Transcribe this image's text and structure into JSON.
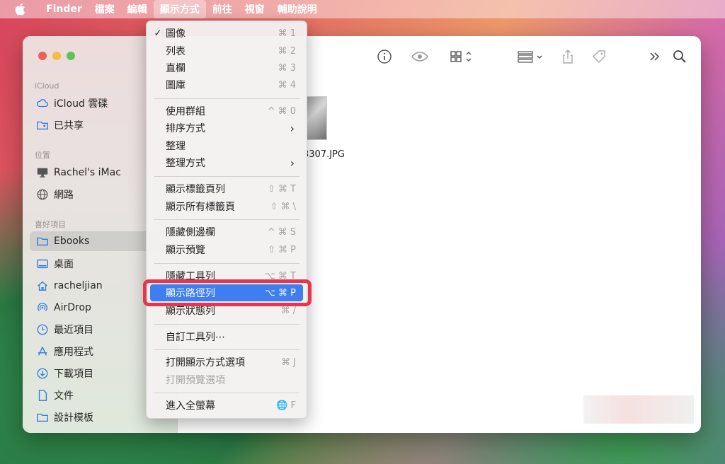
{
  "menubar": {
    "app": "Finder",
    "items": [
      "檔案",
      "編輯",
      "顯示方式",
      "前往",
      "視窗",
      "輔助說明"
    ]
  },
  "sidebar": {
    "icloud_header": "iCloud",
    "icloud_drive": "iCloud 雲碟",
    "shared": "已共享",
    "locations_header": "位置",
    "imac": "Rachel's iMac",
    "network": "網路",
    "favorites_header": "喜好項目",
    "ebooks": "Ebooks",
    "desktop": "桌面",
    "home": "racheljian",
    "airdrop": "AirDrop",
    "recents": "最近項目",
    "applications": "應用程式",
    "downloads": "下載項目",
    "documents": "文件",
    "design": "設計模板"
  },
  "file": {
    "name": "3307.JPG"
  },
  "menu": {
    "icon": {
      "label": "圖像",
      "shortcut": "⌘ 1",
      "check": "✓"
    },
    "list": {
      "label": "列表",
      "shortcut": "⌘ 2"
    },
    "column": {
      "label": "直欄",
      "shortcut": "⌘ 3"
    },
    "gallery": {
      "label": "圖庫",
      "shortcut": "⌘ 4"
    },
    "use_groups": {
      "label": "使用群組",
      "shortcut": "^ ⌘ 0"
    },
    "sort_by": {
      "label": "排序方式"
    },
    "clean_up": {
      "label": "整理"
    },
    "clean_up_by": {
      "label": "整理方式"
    },
    "show_tab_bar": {
      "label": "顯示標籤頁列",
      "shortcut": "⇧ ⌘ T"
    },
    "show_all_tabs": {
      "label": "顯示所有標籤頁",
      "shortcut": "⇧ ⌘ \\"
    },
    "hide_sidebar": {
      "label": "隱藏側邊欄",
      "shortcut": "^ ⌘ S"
    },
    "show_preview": {
      "label": "顯示預覽",
      "shortcut": "⇧ ⌘ P"
    },
    "hide_toolbar": {
      "label": "隱藏工具列",
      "shortcut": "⌥ ⌘ T"
    },
    "show_path_bar": {
      "label": "顯示路徑列",
      "shortcut": "⌥ ⌘ P"
    },
    "show_status_bar": {
      "label": "顯示狀態列",
      "shortcut": "⌘ /"
    },
    "customize_toolbar": {
      "label": "自訂工具列⋯"
    },
    "show_view_options": {
      "label": "打開顯示方式選項",
      "shortcut": "⌘ J"
    },
    "show_preview_options": {
      "label": "打開預覽選項"
    },
    "enter_full_screen": {
      "label": "進入全螢幕",
      "shortcut": "🌐 F"
    }
  }
}
